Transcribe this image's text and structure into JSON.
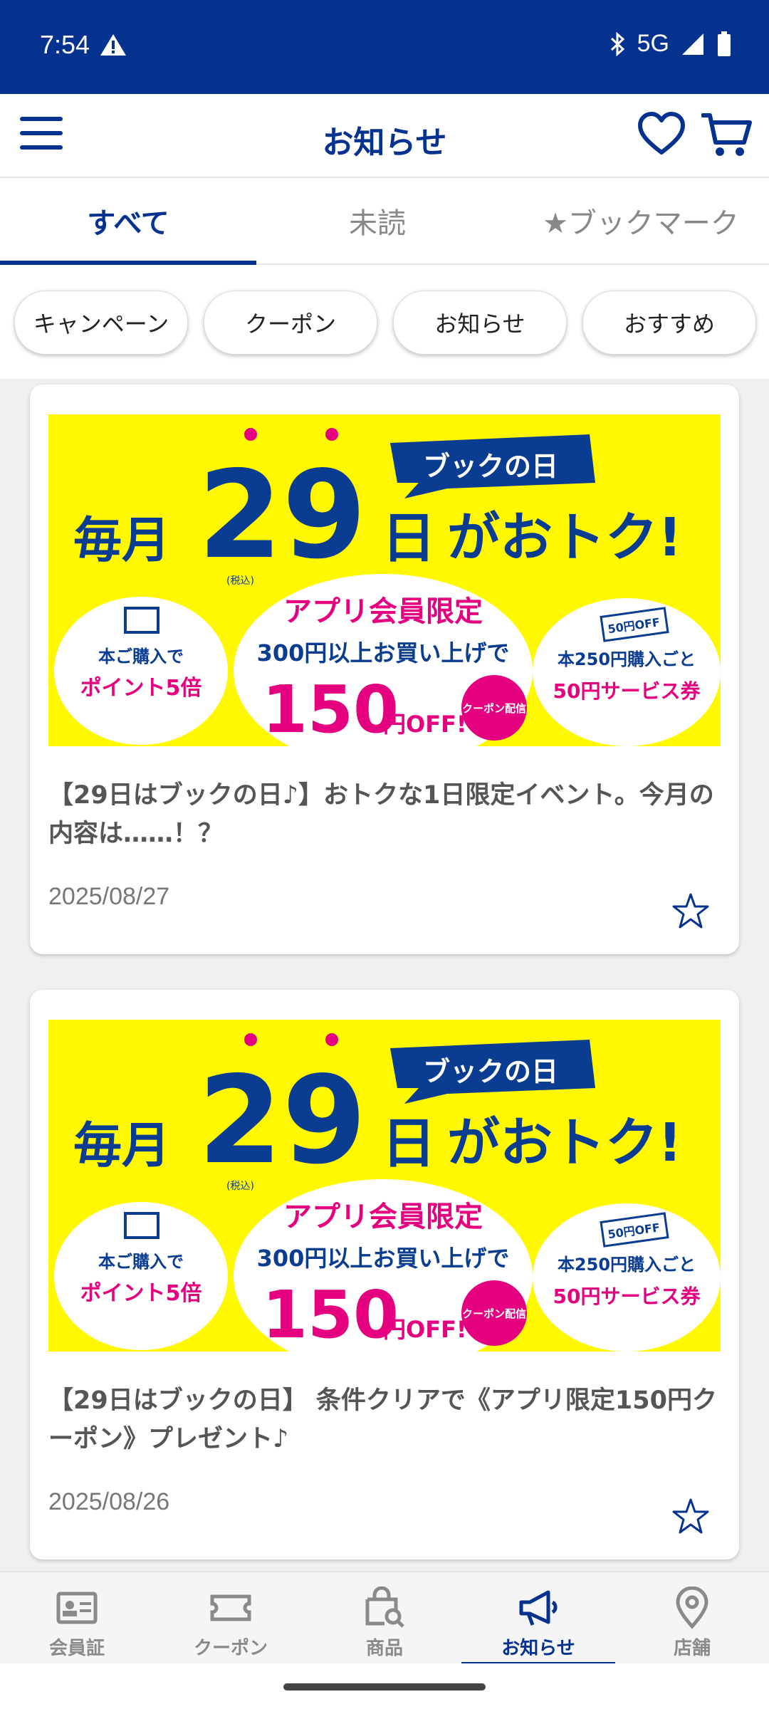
{
  "status_bar": {
    "time": "7:54",
    "network": "5G"
  },
  "app_bar": {
    "title": "お知らせ"
  },
  "tabs": [
    {
      "label": "すべて"
    },
    {
      "label": "未読"
    },
    {
      "label": "★ブックマーク"
    }
  ],
  "chips": [
    {
      "label": "キャンペーン"
    },
    {
      "label": "クーポン"
    },
    {
      "label": "お知らせ"
    },
    {
      "label": "おすすめ"
    }
  ],
  "banner": {
    "monthly": "毎月",
    "day": "29",
    "day_suffix": "日",
    "otoku": "がおトク!",
    "book_day": "ブックの日",
    "left_line1": "本ご購入で",
    "left_line2": "ポイント5倍",
    "center_line1": "アプリ会員限定",
    "center_line2": "300円以上お買い上げで",
    "tax": "(税込)",
    "center_line3": "150",
    "yen_off": "円OFF!",
    "coupon_badge": "クーポン配信",
    "ticket": "50円OFF",
    "right_line1": "本250円購入ごと",
    "right_line2": "50円サービス券"
  },
  "cards": [
    {
      "title": "【29日はブックの日♪】おトクな1日限定イベント。今月の内容は……！？",
      "date": "2025/08/27"
    },
    {
      "title": "【29日はブックの日】 条件クリアで《アプリ限定150円クーポン》プレゼント♪",
      "date": "2025/08/26"
    }
  ],
  "bottom_nav": [
    {
      "label": "会員証",
      "icon": "member-card-icon"
    },
    {
      "label": "クーポン",
      "icon": "ticket-icon"
    },
    {
      "label": "商品",
      "icon": "shopping-bag-search-icon"
    },
    {
      "label": "お知らせ",
      "icon": "megaphone-icon",
      "active": true
    },
    {
      "label": "店舗",
      "icon": "location-pin-icon"
    }
  ],
  "colors": {
    "primary": "#05318f",
    "banner_yellow": "#fff800",
    "banner_pink": "#e4007f",
    "banner_blue": "#0a3d91"
  }
}
